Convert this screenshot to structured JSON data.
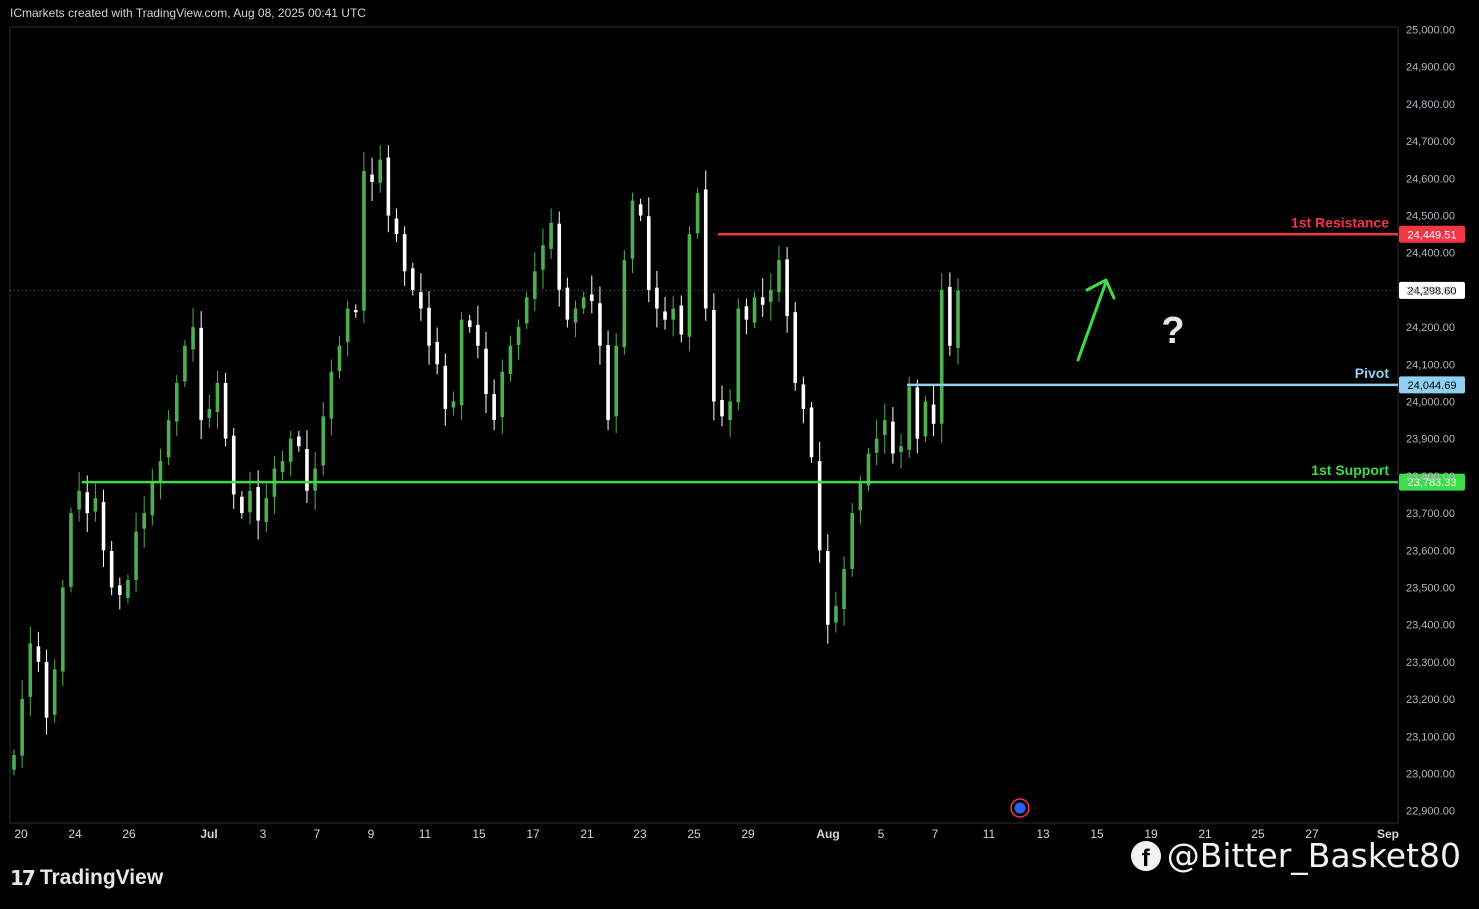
{
  "header": {
    "caption": "ICmarkets created with TradingView.com, Aug 08, 2025 00:41 UTC"
  },
  "footer": {
    "logo_text": "TradingView",
    "logo_mark": "17"
  },
  "watermark": {
    "text": "@Bitter_Basket80",
    "icon": "facebook-icon"
  },
  "colors": {
    "up": "#4caf50",
    "down": "#ffffff",
    "resistance": "#f23645",
    "pivot": "#8fd0f0",
    "support": "#3ddc4a",
    "arrow": "#3ddc4a"
  },
  "chart_data": {
    "type": "candlestick",
    "title": "",
    "ylim": [
      22850,
      25000
    ],
    "ylabel": "",
    "xlabel": "",
    "y_ticks": [
      "25,000.00",
      "24,900.00",
      "24,800.00",
      "24,700.00",
      "24,600.00",
      "24,500.00",
      "24,400.00",
      "24,300.00",
      "24,200.00",
      "24,100.00",
      "24,000.00",
      "23,900.00",
      "23,800.00",
      "23,700.00",
      "23,600.00",
      "23,500.00",
      "23,400.00",
      "23,300.00",
      "23,200.00",
      "23,100.00",
      "23,000.00",
      "22,900.00"
    ],
    "x_ticks": [
      "20",
      "24",
      "26",
      "Jul",
      "3",
      "7",
      "9",
      "11",
      "15",
      "17",
      "21",
      "23",
      "25",
      "29",
      "Aug",
      "5",
      "7",
      "11",
      "13",
      "15",
      "19",
      "21",
      "25",
      "27",
      "Sep"
    ],
    "last_price": {
      "value": 24298.6,
      "label": "24,298.60"
    },
    "levels": [
      {
        "name": "1st Resistance",
        "value": 24449.51,
        "label": "24,449.51",
        "color": "#f23645"
      },
      {
        "name": "Pivot",
        "value": 24044.69,
        "label": "24,044.69",
        "color": "#8fd0f0"
      },
      {
        "name": "1st Support",
        "value": 23783.33,
        "label": "23,783.33",
        "color": "#3ddc4a"
      }
    ],
    "annotations": [
      {
        "type": "arrow",
        "direction": "up"
      },
      {
        "type": "text",
        "text": "?"
      }
    ],
    "close_series": [
      23050,
      23200,
      23350,
      23300,
      23150,
      23280,
      23500,
      23700,
      23760,
      23700,
      23740,
      23600,
      23500,
      23480,
      23520,
      23650,
      23700,
      23780,
      23840,
      23950,
      24050,
      24150,
      24200,
      23950,
      23980,
      24050,
      23900,
      23750,
      23700,
      23760,
      23680,
      23740,
      23820,
      23840,
      23900,
      23880,
      23760,
      23820,
      23960,
      24080,
      24150,
      24250,
      24240,
      24620,
      24590,
      24650,
      24500,
      24450,
      24350,
      24300,
      24250,
      24150,
      24100,
      23980,
      24000,
      24220,
      24200,
      24150,
      24020,
      23950,
      24080,
      24150,
      24200,
      24280,
      24350,
      24420,
      24480,
      24300,
      24220,
      24250,
      24280,
      24270,
      24150,
      23950,
      24150,
      24380,
      24540,
      24500,
      24300,
      24250,
      24220,
      24250,
      24180,
      24450,
      24560,
      24250,
      24000,
      23960,
      24000,
      24250,
      24220,
      24280,
      24260,
      24300,
      24380,
      24230,
      24050,
      23980,
      23850,
      23600,
      23400,
      23450,
      23550,
      23700,
      23780,
      23860,
      23900,
      23950,
      23860,
      23880,
      24040,
      23900,
      24000,
      23940,
      24300,
      24150,
      24298.6
    ]
  }
}
